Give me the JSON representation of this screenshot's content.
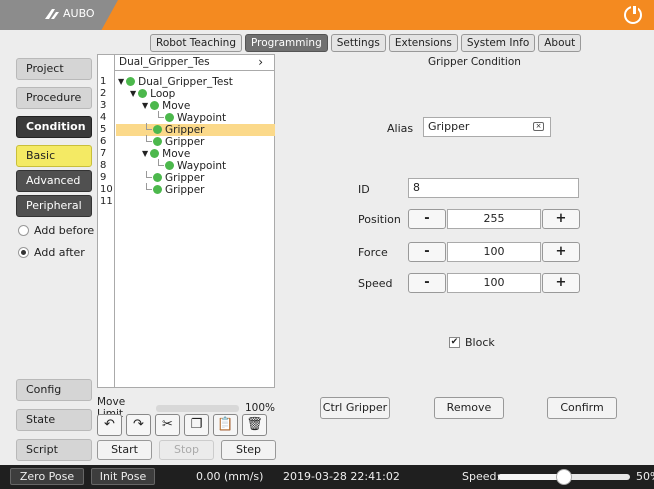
{
  "app": {
    "logo_text": "AUBO"
  },
  "main_tabs": [
    {
      "label": "Robot Teaching",
      "active": false
    },
    {
      "label": "Programming",
      "active": true
    },
    {
      "label": "Settings",
      "active": false
    },
    {
      "label": "Extensions",
      "active": false
    },
    {
      "label": "System Info",
      "active": false
    },
    {
      "label": "About",
      "active": false
    }
  ],
  "nav": {
    "project": "Project",
    "procedure": "Procedure",
    "condition": "Condition",
    "basic": "Basic",
    "advanced": "Advanced",
    "peripheral": "Peripheral",
    "add_before": "Add before",
    "add_after": "Add after",
    "config": "Config",
    "state": "State",
    "script": "Script"
  },
  "tree": {
    "header": "Dual_Gripper_Tes",
    "line_numbers": [
      "1",
      "2",
      "3",
      "4",
      "5",
      "6",
      "7",
      "8",
      "9",
      "10",
      "11"
    ],
    "rows": [
      {
        "label": "Dual_Gripper_Test"
      },
      {
        "label": "Loop"
      },
      {
        "label": "Move"
      },
      {
        "label": "Waypoint"
      },
      {
        "label": "Gripper"
      },
      {
        "label": "Gripper"
      },
      {
        "label": "Move"
      },
      {
        "label": "Waypoint"
      },
      {
        "label": "Gripper"
      },
      {
        "label": "Gripper"
      }
    ]
  },
  "move_limit": {
    "label": "Move Limit",
    "value": "100%"
  },
  "steps": {
    "start": "Start",
    "stop": "Stop",
    "step": "Step"
  },
  "panel": {
    "title": "Gripper Condition",
    "alias_label": "Alias",
    "alias_value": "Gripper",
    "id_label": "ID",
    "id_value": "8",
    "position_label": "Position",
    "position_value": "255",
    "force_label": "Force",
    "force_value": "100",
    "speed_label": "Speed",
    "speed_value": "100",
    "minus": "-",
    "plus": "+",
    "block_label": "Block",
    "ctrl_gripper": "Ctrl Gripper",
    "remove": "Remove",
    "confirm": "Confirm"
  },
  "status": {
    "zero_pose": "Zero Pose",
    "init_pose": "Init Pose",
    "velocity": "0.00 (mm/s)",
    "datetime": "2019-03-28 22:41:02",
    "speed_label": "Speed:",
    "speed_value": "50%",
    "speed_fraction": 0.5
  },
  "colors": {
    "accent": "#f48a20",
    "selection": "#fbd98a",
    "basic": "#f4ea64"
  }
}
